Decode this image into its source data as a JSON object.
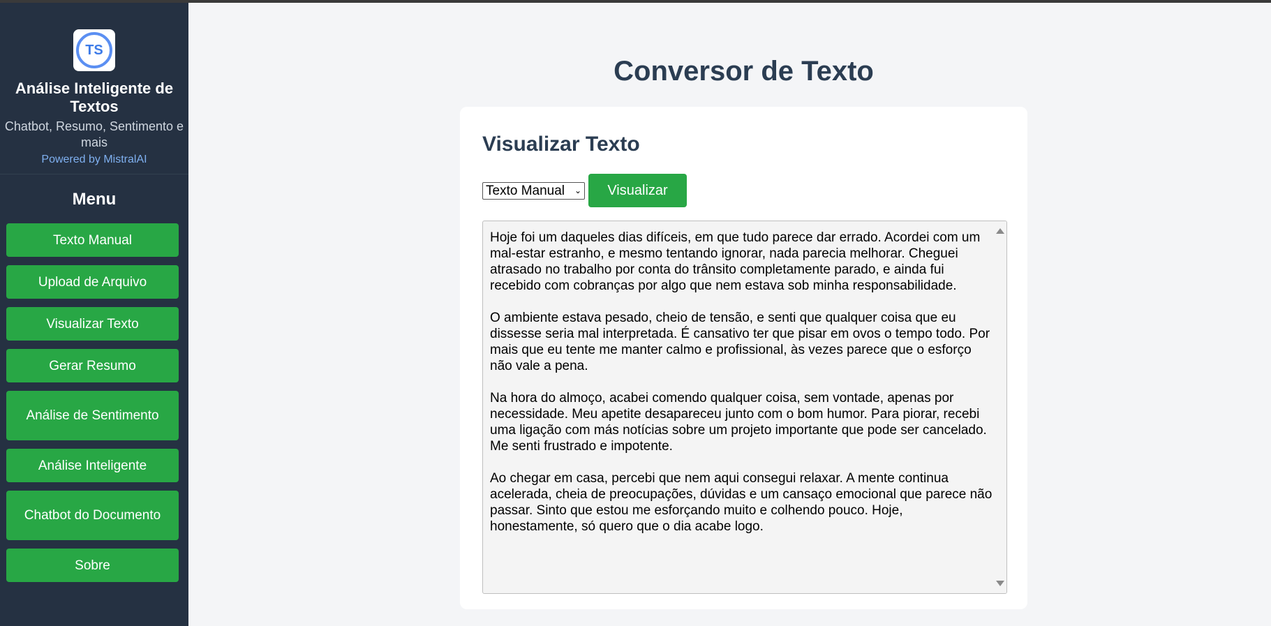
{
  "brand": {
    "logo_text": "TS",
    "title": "Análise Inteligente de Textos",
    "subtitle": "Chatbot, Resumo, Sentimento e mais",
    "powered": "Powered by MistralAI"
  },
  "menu": {
    "title": "Menu",
    "items": [
      {
        "label": "Texto Manual"
      },
      {
        "label": "Upload de Arquivo"
      },
      {
        "label": "Visualizar Texto"
      },
      {
        "label": "Gerar Resumo"
      },
      {
        "label": "Análise de Sentimento"
      },
      {
        "label": "Análise Inteligente"
      },
      {
        "label": "Chatbot do Documento"
      },
      {
        "label": "Sobre"
      }
    ]
  },
  "page": {
    "title": "Conversor de Texto"
  },
  "card": {
    "title": "Visualizar Texto",
    "select_value": "Texto Manual",
    "button_label": "Visualizar",
    "paragraphs": [
      "Hoje foi um daqueles dias difíceis, em que tudo parece dar errado. Acordei com um mal-estar estranho, e mesmo tentando ignorar, nada parecia melhorar. Cheguei atrasado no trabalho por conta do trânsito completamente parado, e ainda fui recebido com cobranças por algo que nem estava sob minha responsabilidade.",
      "O ambiente estava pesado, cheio de tensão, e senti que qualquer coisa que eu dissesse seria mal interpretada. É cansativo ter que pisar em ovos o tempo todo. Por mais que eu tente me manter calmo e profissional, às vezes parece que o esforço não vale a pena.",
      "Na hora do almoço, acabei comendo qualquer coisa, sem vontade, apenas por necessidade. Meu apetite desapareceu junto com o bom humor. Para piorar, recebi uma ligação com más notícias sobre um projeto importante que pode ser cancelado. Me senti frustrado e impotente.",
      "Ao chegar em casa, percebi que nem aqui consegui relaxar. A mente continua acelerada, cheia de preocupações, dúvidas e um cansaço emocional que parece não passar. Sinto que estou me esforçando muito e colhendo pouco. Hoje, honestamente, só quero que o dia acabe logo."
    ]
  }
}
